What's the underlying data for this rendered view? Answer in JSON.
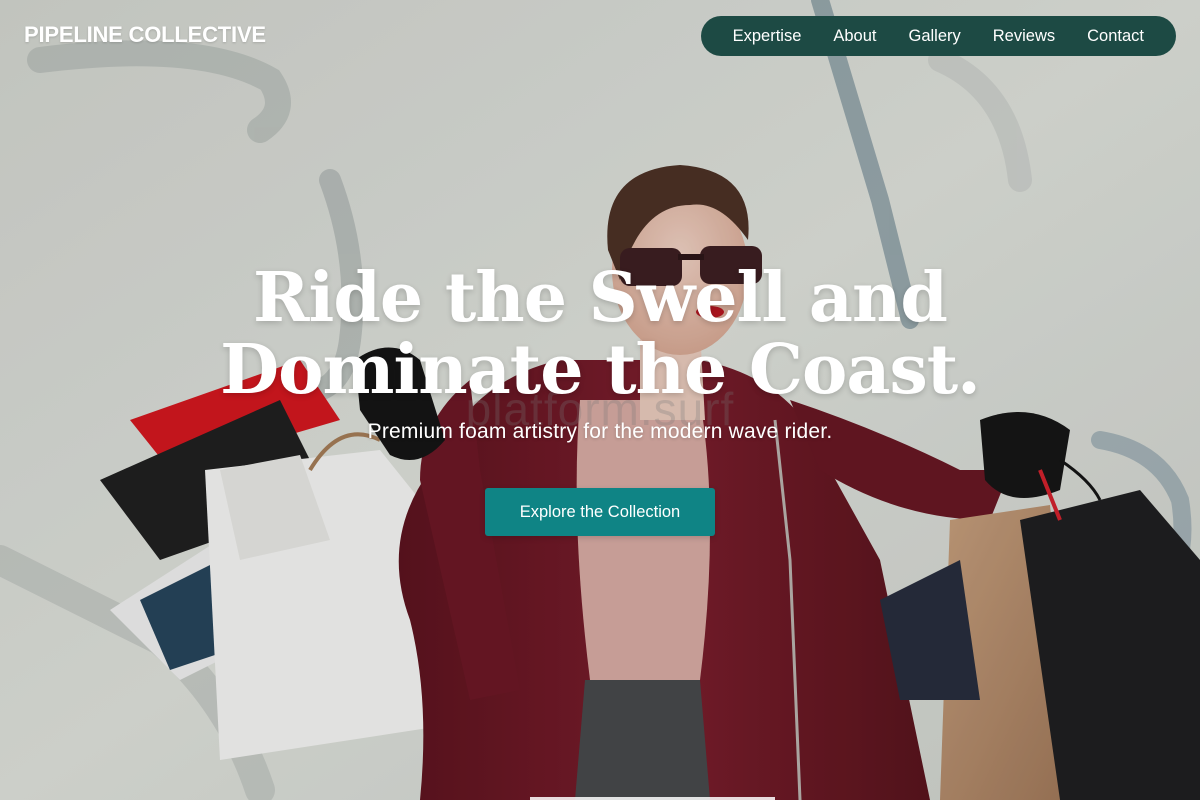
{
  "brand": {
    "name": "PIPELINE COLLECTIVE"
  },
  "nav": {
    "items": [
      {
        "label": "Expertise"
      },
      {
        "label": "About"
      },
      {
        "label": "Gallery"
      },
      {
        "label": "Reviews"
      },
      {
        "label": "Contact"
      }
    ]
  },
  "hero": {
    "title_line1": "Ride the Swell and",
    "title_line2": "Dominate the Coast.",
    "subtitle": "Premium foam artistry for the modern wave rider.",
    "watermark": "platform.surf",
    "cta_label": "Explore the Collection",
    "background_image": "woman-with-shopping-bags-photo"
  },
  "colors": {
    "nav_background": "#1d4a44",
    "cta_background": "#0f8485",
    "text": "#ffffff",
    "coat": "#6b1522",
    "wall": "#d7dad5"
  }
}
